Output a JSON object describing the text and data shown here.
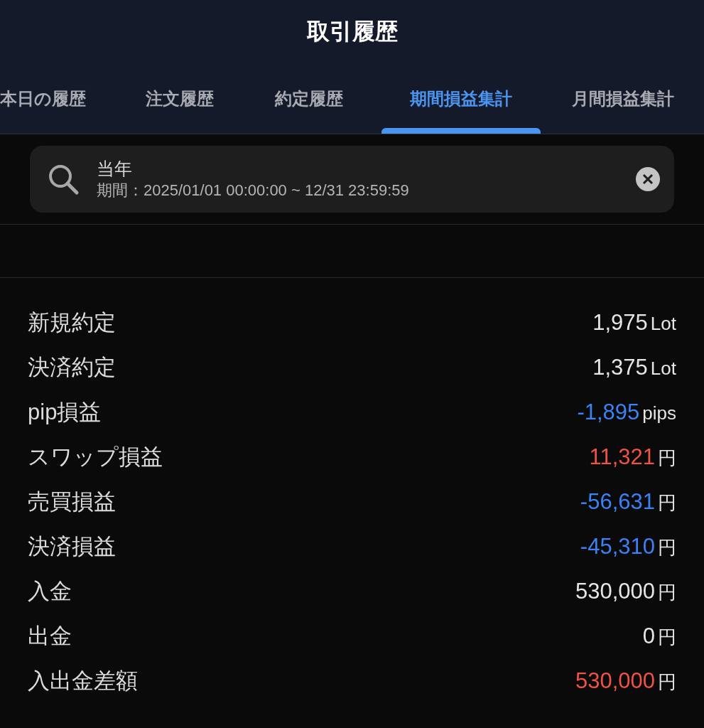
{
  "header": {
    "title": "取引履歴"
  },
  "tabs": [
    {
      "label": "本日の履歴",
      "selected": false
    },
    {
      "label": "注文履歴",
      "selected": false
    },
    {
      "label": "約定履歴",
      "selected": false
    },
    {
      "label": "期間損益集計",
      "selected": true
    },
    {
      "label": "月間損益集計",
      "selected": false
    }
  ],
  "search": {
    "title": "当年",
    "period": "期間：2025/01/01 00:00:00 ~ 12/31 23:59:59"
  },
  "summary": [
    {
      "label": "新規約定",
      "value": "1,975",
      "unit": "Lot",
      "color": "#e6e6e6"
    },
    {
      "label": "決済約定",
      "value": "1,375",
      "unit": "Lot",
      "color": "#e6e6e6"
    },
    {
      "label": "pip損益",
      "value": "-1,895",
      "unit": "pips",
      "color": "#3b82f6"
    },
    {
      "label": "スワップ損益",
      "value": "11,321",
      "unit": "円",
      "color": "#ef5342"
    },
    {
      "label": "売買損益",
      "value": "-56,631",
      "unit": "円",
      "color": "#3b82f6"
    },
    {
      "label": "決済損益",
      "value": "-45,310",
      "unit": "円",
      "color": "#3b82f6"
    },
    {
      "label": "入金",
      "value": "530,000",
      "unit": "円",
      "color": "#e6e6e6"
    },
    {
      "label": "出金",
      "value": "0",
      "unit": "円",
      "color": "#e6e6e6"
    },
    {
      "label": "入出金差額",
      "value": "530,000",
      "unit": "円",
      "color": "#ef5342"
    }
  ]
}
